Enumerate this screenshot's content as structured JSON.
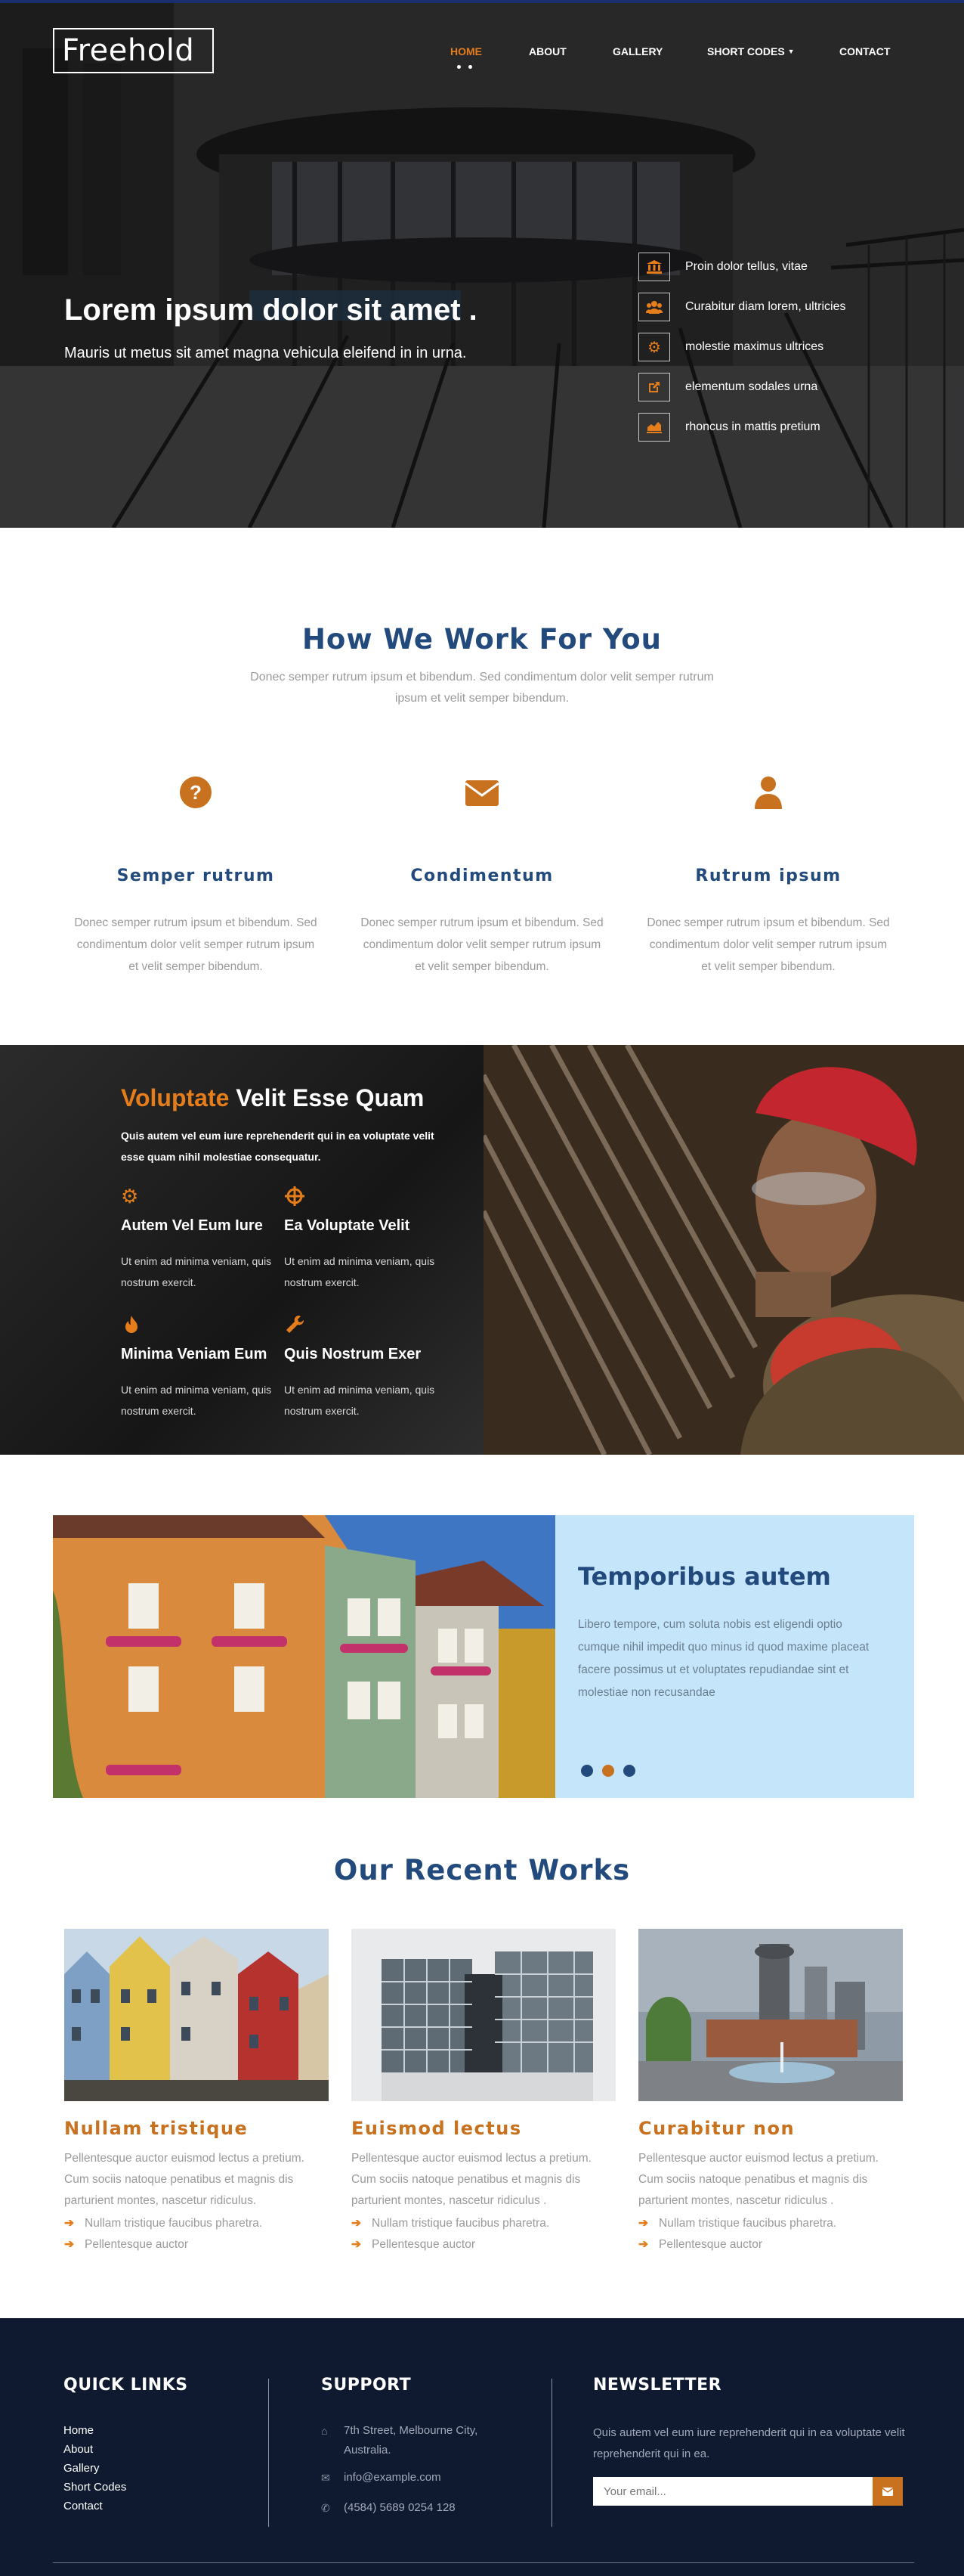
{
  "header": {
    "logo": "Freehold",
    "nav": [
      "HOME",
      "ABOUT",
      "GALLERY",
      "SHORT CODES",
      "CONTACT"
    ],
    "active_nav": "HOME"
  },
  "hero": {
    "title": "Lorem ipsum dolor sit amet .",
    "subtitle": "Mauris ut metus sit amet magna vehicula eleifend in in urna.",
    "features": [
      {
        "icon": "bank-icon",
        "text": "Proin dolor tellus, vitae"
      },
      {
        "icon": "users-icon",
        "text": "Curabitur diam lorem, ultricies"
      },
      {
        "icon": "gear-icon",
        "text": "molestie maximus ultrices"
      },
      {
        "icon": "external-link-icon",
        "text": "elementum sodales urna"
      },
      {
        "icon": "chart-icon",
        "text": "rhoncus in mattis pretium"
      }
    ]
  },
  "how": {
    "title": "How We Work For You",
    "subtitle": "Donec semper rutrum ipsum et bibendum. Sed condimentum dolor velit semper rutrum ipsum et velit semper bibendum.",
    "columns": [
      {
        "icon": "question-circle-icon",
        "title": "Semper rutrum",
        "text": "Donec semper rutrum ipsum et bibendum. Sed condimentum dolor velit semper rutrum ipsum et velit semper bibendum."
      },
      {
        "icon": "envelope-icon",
        "title": "Condimentum",
        "text": "Donec semper rutrum ipsum et bibendum. Sed condimentum dolor velit semper rutrum ipsum et velit semper bibendum."
      },
      {
        "icon": "user-icon",
        "title": "Rutrum ipsum",
        "text": "Donec semper rutrum ipsum et bibendum. Sed condimentum dolor velit semper rutrum ipsum et velit semper bibendum."
      }
    ]
  },
  "voluptate": {
    "title_accent": "Voluptate",
    "title_rest": "Velit Esse Quam",
    "desc": "Quis autem vel eum iure reprehenderit qui in ea voluptate velit esse quam nihil molestiae consequatur.",
    "items": [
      {
        "icon": "cog-icon",
        "title": "Autem Vel Eum Iure",
        "text": "Ut enim ad minima veniam, quis nostrum exercit."
      },
      {
        "icon": "crosshair-icon",
        "title": "Ea Voluptate Velit",
        "text": "Ut enim ad minima veniam, quis nostrum exercit."
      },
      {
        "icon": "fire-icon",
        "title": "Minima Veniam Eum",
        "text": "Ut enim ad minima veniam, quis nostrum exercit."
      },
      {
        "icon": "wrench-icon",
        "title": "Quis Nostrum Exer",
        "text": "Ut enim ad minima veniam, quis nostrum exercit."
      }
    ]
  },
  "slider": {
    "title": "Temporibus autem",
    "text": "Libero tempore, cum soluta nobis est eligendi optio cumque nihil impedit quo minus id quod maxime placeat facere possimus ut et voluptates repudiandae sint et molestiae non recusandae"
  },
  "works": {
    "title": "Our Recent Works",
    "items": [
      {
        "title": "Nullam tristique",
        "text": "Pellentesque auctor euismod lectus a pretium. Cum sociis natoque penatibus et magnis dis parturient montes, nascetur ridiculus.",
        "bullets": [
          "Nullam tristique faucibus pharetra.",
          "Pellentesque auctor"
        ]
      },
      {
        "title": "Euismod lectus",
        "text": "Pellentesque auctor euismod lectus a pretium. Cum sociis natoque penatibus et magnis dis parturient montes, nascetur ridiculus .",
        "bullets": [
          "Nullam tristique faucibus pharetra.",
          "Pellentesque auctor"
        ]
      },
      {
        "title": "Curabitur non",
        "text": "Pellentesque auctor euismod lectus a pretium. Cum sociis natoque penatibus et magnis dis parturient montes, nascetur ridiculus .",
        "bullets": [
          "Nullam tristique faucibus pharetra.",
          "Pellentesque auctor"
        ]
      }
    ]
  },
  "footer": {
    "quick_links_title": "QUICK LINKS",
    "links": [
      "Home",
      "About",
      "Gallery",
      "Short Codes",
      "Contact"
    ],
    "support_title": "SUPPORT",
    "address": "7th Street, Melbourne City, Australia.",
    "email": "info@example.com",
    "phone": "(4584) 5689 0254 128",
    "newsletter_title": "NEWSLETTER",
    "newsletter_text": "Quis autem vel eum iure reprehenderit qui in ea voluptate velit reprehenderit qui in ea.",
    "email_placeholder": "Your email..."
  },
  "colors": {
    "accent": "#e57d1b",
    "heading_blue": "#234a7c",
    "footer_bg": "#0f1a31",
    "slider_panel": "#c5e5fb"
  }
}
